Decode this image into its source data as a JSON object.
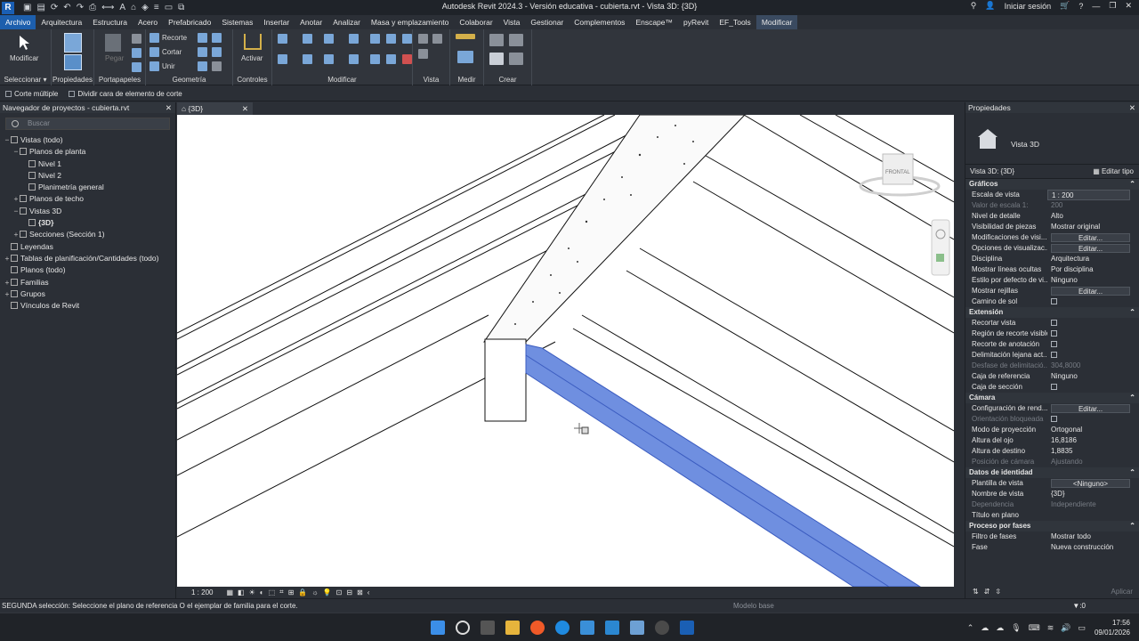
{
  "app": {
    "title": "Autodesk Revit 2024.3 - Versión educativa - cubierta.rvt - Vista 3D: {3D}",
    "logo": "R",
    "signin": "Iniciar sesión"
  },
  "menu": [
    "Archivo",
    "Arquitectura",
    "Estructura",
    "Acero",
    "Prefabricado",
    "Sistemas",
    "Insertar",
    "Anotar",
    "Analizar",
    "Masa y emplazamiento",
    "Colaborar",
    "Vista",
    "Gestionar",
    "Complementos",
    "Enscape™",
    "pyRevit",
    "EF_Tools",
    "Modificar"
  ],
  "ribbon": {
    "modify": "Modificar",
    "select": "Seleccionar ▾",
    "properties": "Propiedades",
    "clipboard": "Portapapeles",
    "paste": "Pegar",
    "geometry": "Geometría",
    "cope": "Recorte",
    "cut": "Cortar",
    "join": "Unir",
    "activate": "Activar",
    "controls": "Controles",
    "modify_panel": "Modificar",
    "view": "Vista",
    "measure": "Medir",
    "create": "Crear"
  },
  "options": {
    "multiple_cut": "Corte múltiple",
    "split_face": "Dividir cara de elemento de corte"
  },
  "browser": {
    "title": "Navegador de proyectos - cubierta.rvt",
    "search_placeholder": "Buscar",
    "nodes": [
      {
        "label": "Vistas (todo)",
        "indent": 0,
        "toggle": "−"
      },
      {
        "label": "Planos de planta",
        "indent": 1,
        "toggle": "−"
      },
      {
        "label": "Nivel 1",
        "indent": 2,
        "toggle": ""
      },
      {
        "label": "Nivel 2",
        "indent": 2,
        "toggle": ""
      },
      {
        "label": "Planimetría general",
        "indent": 2,
        "toggle": ""
      },
      {
        "label": "Planos de techo",
        "indent": 1,
        "toggle": "+"
      },
      {
        "label": "Vistas 3D",
        "indent": 1,
        "toggle": "−"
      },
      {
        "label": "{3D}",
        "indent": 2,
        "toggle": "",
        "bold": true
      },
      {
        "label": "Secciones (Sección 1)",
        "indent": 1,
        "toggle": "+"
      },
      {
        "label": "Leyendas",
        "indent": 0,
        "toggle": ""
      },
      {
        "label": "Tablas de planificación/Cantidades (todo)",
        "indent": 0,
        "toggle": "+"
      },
      {
        "label": "Planos (todo)",
        "indent": 0,
        "toggle": ""
      },
      {
        "label": "Familias",
        "indent": 0,
        "toggle": "+"
      },
      {
        "label": "Grupos",
        "indent": 0,
        "toggle": "+"
      },
      {
        "label": "Vínculos de Revit",
        "indent": 0,
        "toggle": ""
      }
    ]
  },
  "view_tab": "{3D}",
  "viewcube": "FRONTAL",
  "view_scale": "1 : 200",
  "properties": {
    "title": "Propiedades",
    "type_name": "Vista 3D",
    "selector": "Vista 3D: {3D}",
    "edit_type": "Editar tipo",
    "groups": [
      {
        "name": "Gráficos",
        "rows": [
          {
            "k": "Escala de vista",
            "v": "1 : 200",
            "kind": "input"
          },
          {
            "k": "Valor de escala    1:",
            "v": "200",
            "kind": "text",
            "dis": true
          },
          {
            "k": "Nivel de detalle",
            "v": "Alto",
            "kind": "text"
          },
          {
            "k": "Visibilidad de piezas",
            "v": "Mostrar original",
            "kind": "text"
          },
          {
            "k": "Modificaciones de visi...",
            "v": "Editar...",
            "kind": "btn"
          },
          {
            "k": "Opciones de visualizac...",
            "v": "Editar...",
            "kind": "btn"
          },
          {
            "k": "Disciplina",
            "v": "Arquitectura",
            "kind": "text"
          },
          {
            "k": "Mostrar líneas ocultas",
            "v": "Por disciplina",
            "kind": "text"
          },
          {
            "k": "Estilo por defecto de vi...",
            "v": "Ninguno",
            "kind": "text"
          },
          {
            "k": "Mostrar rejillas",
            "v": "Editar...",
            "kind": "btn"
          },
          {
            "k": "Camino de sol",
            "v": "",
            "kind": "check"
          }
        ]
      },
      {
        "name": "Extensión",
        "rows": [
          {
            "k": "Recortar vista",
            "v": "",
            "kind": "check"
          },
          {
            "k": "Región de recorte visible",
            "v": "",
            "kind": "check"
          },
          {
            "k": "Recorte de anotación",
            "v": "",
            "kind": "check"
          },
          {
            "k": "Delimitación lejana act...",
            "v": "",
            "kind": "check"
          },
          {
            "k": "Desfase de delimitació...",
            "v": "304,8000",
            "kind": "text",
            "dis": true
          },
          {
            "k": "Caja de referencia",
            "v": "Ninguno",
            "kind": "text"
          },
          {
            "k": "Caja de sección",
            "v": "",
            "kind": "check"
          }
        ]
      },
      {
        "name": "Cámara",
        "rows": [
          {
            "k": "Configuración de rend...",
            "v": "Editar...",
            "kind": "btn"
          },
          {
            "k": "Orientación bloqueada",
            "v": "",
            "kind": "check",
            "dis": true
          },
          {
            "k": "Modo de proyección",
            "v": "Ortogonal",
            "kind": "text"
          },
          {
            "k": "Altura del ojo",
            "v": "16,8186",
            "kind": "text"
          },
          {
            "k": "Altura de destino",
            "v": "1,8835",
            "kind": "text"
          },
          {
            "k": "Posición de cámara",
            "v": "Ajustando",
            "kind": "text",
            "dis": true
          }
        ]
      },
      {
        "name": "Datos de identidad",
        "rows": [
          {
            "k": "Plantilla de vista",
            "v": "<Ninguno>",
            "kind": "btn"
          },
          {
            "k": "Nombre de vista",
            "v": "{3D}",
            "kind": "text"
          },
          {
            "k": "Dependencia",
            "v": "Independiente",
            "kind": "text",
            "dis": true
          },
          {
            "k": "Título en plano",
            "v": "",
            "kind": "text"
          }
        ]
      },
      {
        "name": "Proceso por fases",
        "rows": [
          {
            "k": "Filtro de fases",
            "v": "Mostrar todo",
            "kind": "text"
          },
          {
            "k": "Fase",
            "v": "Nueva construcción",
            "kind": "text"
          }
        ]
      }
    ],
    "apply": "Aplicar"
  },
  "status": {
    "message": "SEGUNDA selección: Seleccione el plano de referencia O el ejemplar de familia para el corte.",
    "model": "Modelo base",
    "filter_count": ":0"
  },
  "taskbar": {
    "time": "17:56",
    "date": "09/01/2026"
  },
  "colors": {
    "selection": "#5b7fdb",
    "accent": "#1d5fad"
  }
}
